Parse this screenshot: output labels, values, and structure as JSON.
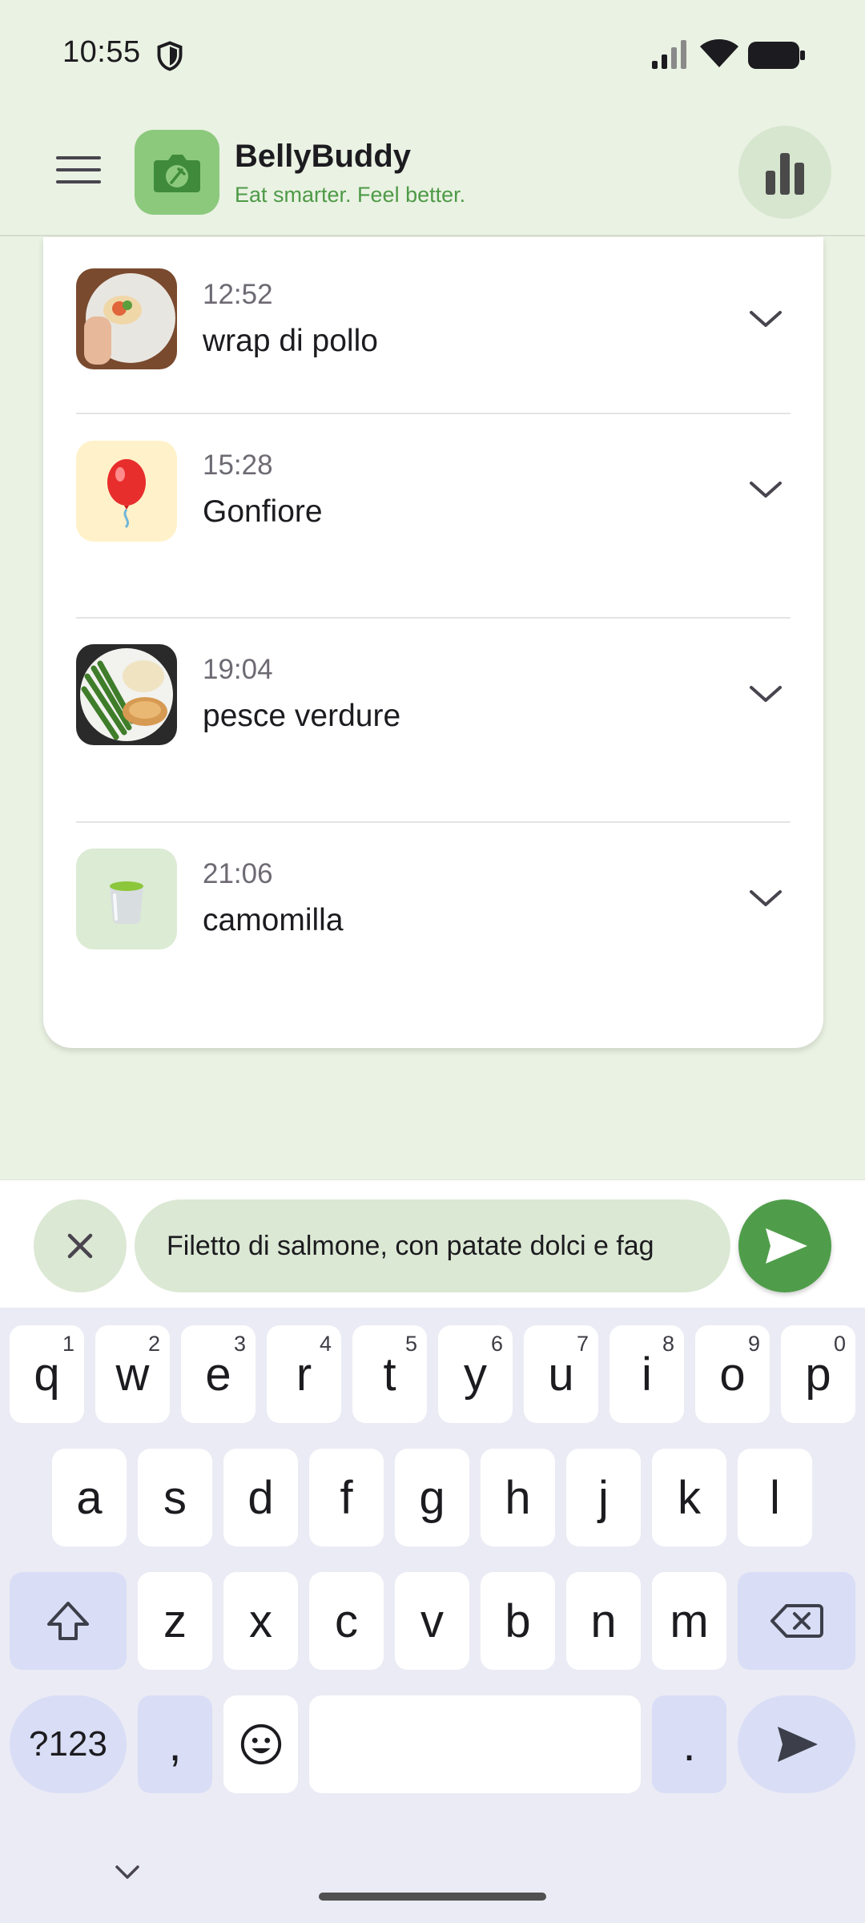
{
  "status_bar": {
    "time": "10:55",
    "icons": [
      "shield-icon",
      "cell-signal-icon",
      "wifi-icon",
      "battery-icon"
    ]
  },
  "app_bar": {
    "title": "BellyBuddy",
    "subtitle": "Eat smarter. Feel better.",
    "menu_icon": "menu-icon",
    "logo_icon": "camera-fork-logo",
    "stats_icon": "bar-chart-icon"
  },
  "entries": [
    {
      "time": "12:52",
      "name": "wrap di pollo",
      "thumb": "food-photo-wrap"
    },
    {
      "time": "15:28",
      "name": "Gonfiore",
      "thumb": "balloon-emoji"
    },
    {
      "time": "19:04",
      "name": "pesce verdure",
      "thumb": "food-photo-fish-vegetables"
    },
    {
      "time": "21:06",
      "name": "camomilla",
      "thumb": "tea-cup-emoji"
    }
  ],
  "input": {
    "value": "Filetto di salmone, con patate dolci e fag",
    "clear_icon": "close-icon",
    "send_icon": "send-icon"
  },
  "keyboard": {
    "row1": [
      {
        "k": "q",
        "h": "1"
      },
      {
        "k": "w",
        "h": "2"
      },
      {
        "k": "e",
        "h": "3"
      },
      {
        "k": "r",
        "h": "4"
      },
      {
        "k": "t",
        "h": "5"
      },
      {
        "k": "y",
        "h": "6"
      },
      {
        "k": "u",
        "h": "7"
      },
      {
        "k": "i",
        "h": "8"
      },
      {
        "k": "o",
        "h": "9"
      },
      {
        "k": "p",
        "h": "0"
      }
    ],
    "row2": [
      "a",
      "s",
      "d",
      "f",
      "g",
      "h",
      "j",
      "k",
      "l"
    ],
    "row3": [
      "z",
      "x",
      "c",
      "v",
      "b",
      "n",
      "m"
    ],
    "symbols": "?123",
    "comma": ",",
    "period": "."
  },
  "colors": {
    "background": "#eaf2e3",
    "accent": "#4f9d4a",
    "field": "#dbe8d4",
    "keyboard": "#ebebf5"
  }
}
